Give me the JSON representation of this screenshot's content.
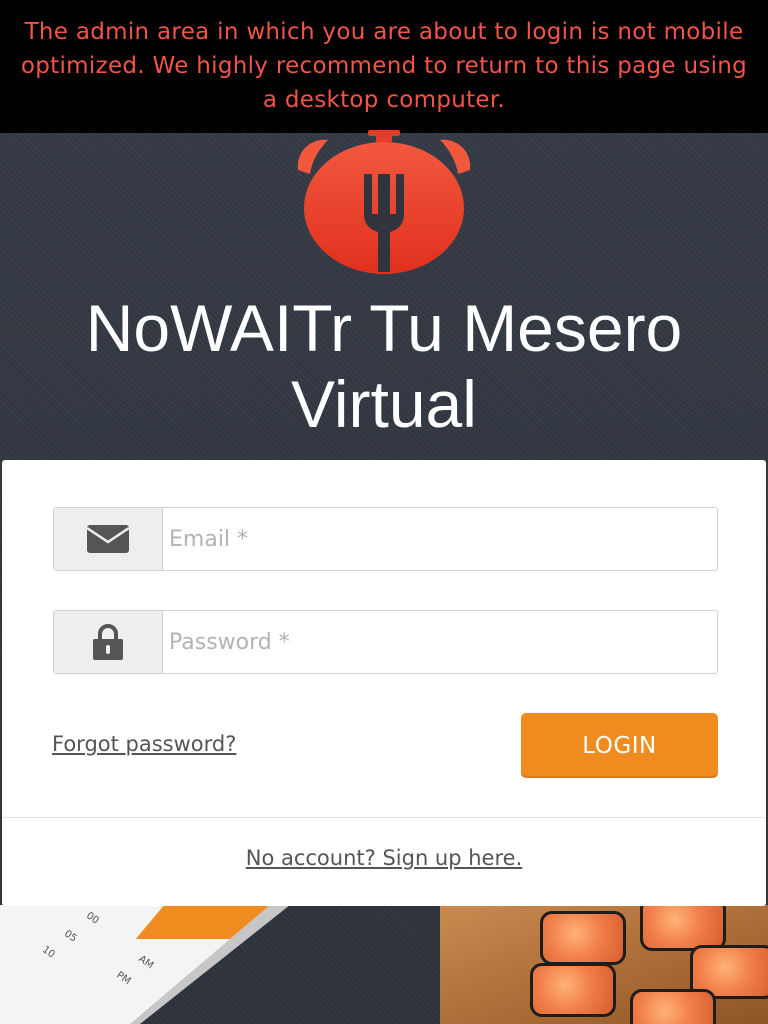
{
  "banner": {
    "message": "The admin area in which you are about to login is not mobile optimized. We highly recommend to return to this page using a desktop computer."
  },
  "brand": {
    "logo_icon": "alarm-clock-fork-icon",
    "title": "NoWAITr Tu Mesero Virtual",
    "accent_color": "#f2544a"
  },
  "login_form": {
    "email_icon": "envelope-icon",
    "email_placeholder": "Email *",
    "email_value": "",
    "password_icon": "lock-icon",
    "password_placeholder": "Password *",
    "password_value": "",
    "forgot_label": "Forgot password?",
    "login_label": "LOGIN",
    "login_color": "#f08c1f"
  },
  "signup": {
    "text": "No account? Sign up here."
  },
  "background": {
    "tablet_labels": [
      "00",
      "05",
      "10",
      "AM",
      "PM"
    ]
  }
}
